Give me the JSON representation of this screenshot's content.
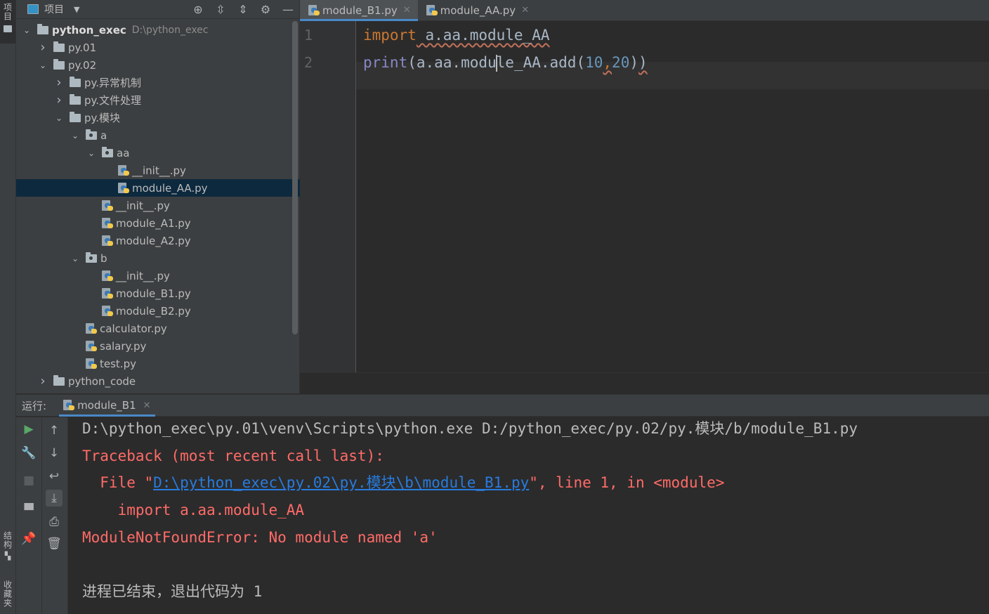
{
  "left_strip": {
    "project_tab": "项目",
    "structure_tab": "结构",
    "favorites_tab": "收藏夹"
  },
  "project_panel": {
    "title": "项目",
    "tree": [
      {
        "label": "python_exec",
        "path": "D:\\python_exec",
        "type": "folder",
        "indent": 0,
        "expanded": true,
        "bold": true
      },
      {
        "label": "py.01",
        "type": "folder",
        "indent": 1,
        "expanded": false
      },
      {
        "label": "py.02",
        "type": "folder",
        "indent": 1,
        "expanded": true
      },
      {
        "label": "py.异常机制",
        "type": "folder",
        "indent": 2,
        "expanded": false
      },
      {
        "label": "py.文件处理",
        "type": "folder",
        "indent": 2,
        "expanded": false
      },
      {
        "label": "py.模块",
        "type": "folder",
        "indent": 2,
        "expanded": true
      },
      {
        "label": "a",
        "type": "package",
        "indent": 3,
        "expanded": true
      },
      {
        "label": "aa",
        "type": "package",
        "indent": 4,
        "expanded": true
      },
      {
        "label": "__init__.py",
        "type": "py",
        "indent": 5
      },
      {
        "label": "module_AA.py",
        "type": "py",
        "indent": 5,
        "selected": true
      },
      {
        "label": "__init__.py",
        "type": "py",
        "indent": 4
      },
      {
        "label": "module_A1.py",
        "type": "py",
        "indent": 4
      },
      {
        "label": "module_A2.py",
        "type": "py",
        "indent": 4
      },
      {
        "label": "b",
        "type": "package",
        "indent": 3,
        "expanded": true
      },
      {
        "label": "__init__.py",
        "type": "py",
        "indent": 4
      },
      {
        "label": "module_B1.py",
        "type": "py",
        "indent": 4
      },
      {
        "label": "module_B2.py",
        "type": "py",
        "indent": 4
      },
      {
        "label": "calculator.py",
        "type": "py",
        "indent": 3
      },
      {
        "label": "salary.py",
        "type": "py",
        "indent": 3
      },
      {
        "label": "test.py",
        "type": "py",
        "indent": 3
      },
      {
        "label": "python_code",
        "type": "folder",
        "indent": 1,
        "expanded": false
      }
    ]
  },
  "editor": {
    "tabs": [
      {
        "label": "module_B1.py",
        "active": true
      },
      {
        "label": "module_AA.py",
        "active": false
      }
    ],
    "line_numbers": [
      "1",
      "2"
    ],
    "code": {
      "l1_kw": "import",
      "l1_rest": " a.aa.module_AA",
      "l2_fn": "print",
      "l2_a": "(a.aa.modu",
      "l2_b": "le_AA.add(",
      "l2_n1": "10",
      "l2_comma": ",",
      "l2_n2": "20",
      "l2_close1": ")",
      "l2_close2": ")"
    }
  },
  "run": {
    "label": "运行:",
    "tab": "module_B1",
    "console": {
      "cmd": "D:\\python_exec\\py.01\\venv\\Scripts\\python.exe D:/python_exec/py.02/py.模块/b/module_B1.py",
      "traceback": "Traceback (most recent call last):",
      "file_prefix": "  File \"",
      "file_link": "D:\\python_exec\\py.02\\py.模块\\b\\module_B1.py",
      "file_suffix": "\", line 1, in <module>",
      "import_line": "    import a.aa.module_AA",
      "error": "ModuleNotFoundError: No module named 'a'",
      "exit": "进程已结束，退出代码为 1"
    }
  },
  "colors": {
    "keyword": "#cc7832",
    "builtin": "#8888c6",
    "number": "#6897bb",
    "error": "#ff6b68",
    "link": "#287bde",
    "selection": "#0d293e"
  }
}
